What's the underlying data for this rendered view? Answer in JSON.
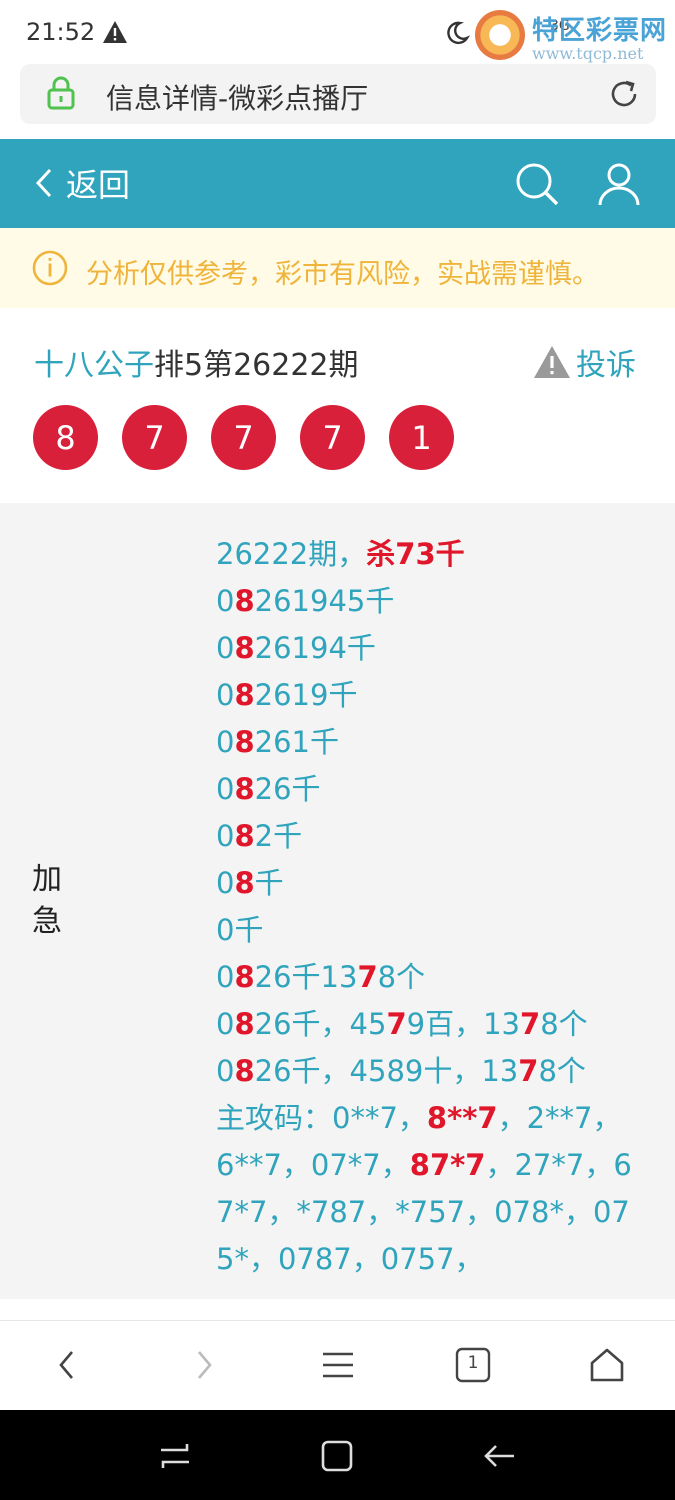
{
  "status_bar": {
    "time": "21:52",
    "signal_text": "3G"
  },
  "watermark": {
    "title": "特区彩票网",
    "url": "www.tqcp.net"
  },
  "address_bar": {
    "url_text": "信息详情-微彩点播厅"
  },
  "header": {
    "back_label": "返回"
  },
  "notice": {
    "text": "分析仅供参考，彩市有风险，实战需谨慎。"
  },
  "post": {
    "author": "十八公子",
    "title_rest": "排5第26222期",
    "complain_label": "投诉",
    "numbers": [
      "8",
      "7",
      "7",
      "7",
      "1"
    ]
  },
  "content": {
    "label": "加急",
    "lines": [
      [
        {
          "t": "26222期，"
        },
        {
          "t": "杀73千",
          "r": true
        }
      ],
      [
        {
          "t": "0"
        },
        {
          "t": "8",
          "r": true
        },
        {
          "t": "261945千"
        }
      ],
      [
        {
          "t": "0"
        },
        {
          "t": "8",
          "r": true
        },
        {
          "t": "26194千"
        }
      ],
      [
        {
          "t": "0"
        },
        {
          "t": "8",
          "r": true
        },
        {
          "t": "2619千"
        }
      ],
      [
        {
          "t": "0"
        },
        {
          "t": "8",
          "r": true
        },
        {
          "t": "261千"
        }
      ],
      [
        {
          "t": "0"
        },
        {
          "t": "8",
          "r": true
        },
        {
          "t": "26千"
        }
      ],
      [
        {
          "t": "0"
        },
        {
          "t": "8",
          "r": true
        },
        {
          "t": "2千"
        }
      ],
      [
        {
          "t": "0"
        },
        {
          "t": "8",
          "r": true
        },
        {
          "t": "千"
        }
      ],
      [
        {
          "t": "0千"
        }
      ],
      [
        {
          "t": "0"
        },
        {
          "t": "8",
          "r": true
        },
        {
          "t": "26千13"
        },
        {
          "t": "7",
          "r": true
        },
        {
          "t": "8个"
        }
      ],
      [
        {
          "t": "0"
        },
        {
          "t": "8",
          "r": true
        },
        {
          "t": "26千，45"
        },
        {
          "t": "7",
          "r": true
        },
        {
          "t": "9百，13"
        },
        {
          "t": "7",
          "r": true
        },
        {
          "t": "8个"
        }
      ],
      [
        {
          "t": "0"
        },
        {
          "t": "8",
          "r": true
        },
        {
          "t": "26千，4589十，13"
        },
        {
          "t": "7",
          "r": true
        },
        {
          "t": "8个"
        }
      ],
      [
        {
          "t": "主攻码：0**7，"
        },
        {
          "t": "8**7",
          "r": true
        },
        {
          "t": "，2**7，"
        }
      ],
      [
        {
          "t": "6**7，07*7，"
        },
        {
          "t": "87*7",
          "r": true
        },
        {
          "t": "，27*7，6"
        }
      ],
      [
        {
          "t": "7*7，*787，*757，078*，07"
        }
      ],
      [
        {
          "t": "5*，0787，0757，"
        }
      ]
    ]
  },
  "bottom_bar": {
    "tab_count": "1"
  },
  "colors": {
    "header": "#2fa4bc",
    "accent_text": "#2fa4bc",
    "ball": "#d9203b",
    "highlight": "#e0162b",
    "notice_bg": "#fffbe6",
    "notice_text": "#efb43c"
  }
}
